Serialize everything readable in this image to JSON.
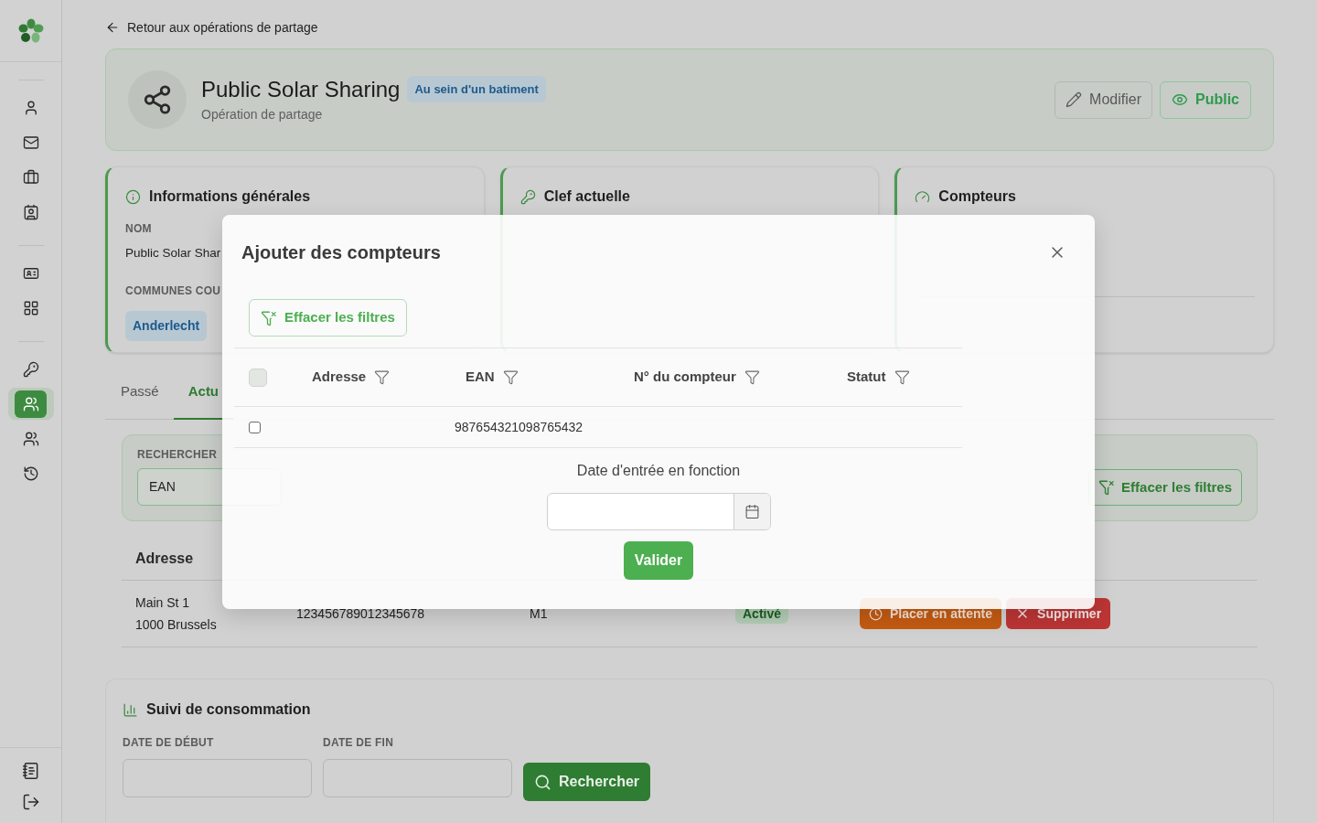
{
  "sidebar": {
    "sections": [
      {
        "items": [
          {
            "selected": false
          },
          {
            "selected": false
          },
          {
            "selected": false
          },
          {
            "selected": false
          }
        ]
      },
      {
        "items": [
          {
            "selected": false
          },
          {
            "selected": false
          }
        ]
      },
      {
        "items": [
          {
            "selected": false
          },
          {
            "selected": true
          },
          {
            "selected": false
          },
          {
            "selected": false
          }
        ]
      }
    ]
  },
  "back_link": "Retour aux opérations de partage",
  "header": {
    "title": "Public Solar Sharing",
    "badge": "Au sein d'un batiment",
    "subtitle": "Opération de partage",
    "buttons": [
      {
        "kind": "edit",
        "label": "Modifier"
      },
      {
        "kind": "visibility",
        "label": "Public"
      }
    ]
  },
  "info_card": {
    "title": "Informations générales",
    "fields": [
      {
        "label": "NOM",
        "value": "Public Solar Shar"
      }
    ],
    "communes_label": "COMMUNES COU",
    "communes": [
      "Anderlecht"
    ]
  },
  "key_card": {
    "title": "Clef actuelle"
  },
  "meters_card": {
    "title": "Compteurs"
  },
  "tabs": [
    {
      "label": "Passé",
      "selected": false
    },
    {
      "label": "Actu",
      "selected": true
    }
  ],
  "filters": {
    "search_label": "RECHERCHER",
    "search_field": "EAN",
    "clear": "Effacer les filtres"
  },
  "table": {
    "columns": [
      "Adresse"
    ],
    "rows": [
      {
        "address": [
          "Main St 1",
          "1000 Brussels"
        ],
        "ean": "123456789012345678",
        "meter": "M1",
        "status": "Activé",
        "actions": [
          {
            "kind": "hold",
            "label": "Placer en attente"
          },
          {
            "kind": "delete",
            "label": "Supprimer"
          }
        ]
      }
    ]
  },
  "consumption": {
    "title": "Suivi de consommation",
    "start_label": "DATE DE DÉBUT",
    "end_label": "DATE DE FIN",
    "button": "Rechercher"
  },
  "modal": {
    "title": "Ajouter des compteurs",
    "clear": "Effacer les filtres",
    "select_all": {
      "checked": false,
      "disabled": true
    },
    "columns": [
      "Adresse",
      "EAN",
      "N° du compteur",
      "Statut"
    ],
    "rows": [
      {
        "selected": false,
        "ean": "987654321098765432"
      }
    ],
    "date_label": "Date d'entrée en fonction",
    "submit": "Valider"
  }
}
